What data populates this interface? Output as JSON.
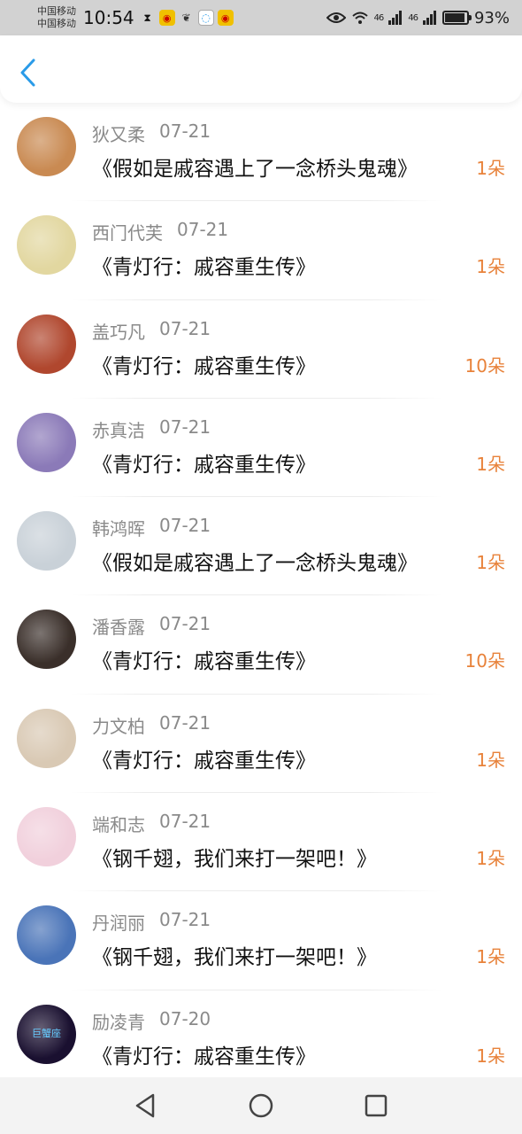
{
  "status": {
    "carrier1": "中国移动",
    "carrier2": "中国移动",
    "time": "10:54",
    "net1": "46",
    "net2": "46",
    "battery": "93%",
    "battery_level": 0.93
  },
  "header": {
    "back_icon": "chevron-left-icon",
    "accent": "#2a9be8"
  },
  "colors": {
    "count": "#e8823a",
    "name": "#8a8a8a"
  },
  "items": [
    {
      "name": "狄又柔",
      "date": "07-21",
      "title": "《假如是戚容遇上了一念桥头鬼魂》",
      "count": "1朵",
      "avatar_color": "#c98a52"
    },
    {
      "name": "西门代芙",
      "date": "07-21",
      "title": "《青灯行：戚容重生传》",
      "count": "1朵",
      "avatar_color": "#e2d7a0"
    },
    {
      "name": "盖巧凡",
      "date": "07-21",
      "title": "《青灯行：戚容重生传》",
      "count": "10朵",
      "avatar_color": "#b0472e"
    },
    {
      "name": "赤真洁",
      "date": "07-21",
      "title": "《青灯行：戚容重生传》",
      "count": "1朵",
      "avatar_color": "#8b7ab8"
    },
    {
      "name": "韩鸿晖",
      "date": "07-21",
      "title": "《假如是戚容遇上了一念桥头鬼魂》",
      "count": "1朵",
      "avatar_color": "#c9d1d8"
    },
    {
      "name": "潘香露",
      "date": "07-21",
      "title": "《青灯行：戚容重生传》",
      "count": "10朵",
      "avatar_color": "#3a2f2a"
    },
    {
      "name": "力文柏",
      "date": "07-21",
      "title": "《青灯行：戚容重生传》",
      "count": "1朵",
      "avatar_color": "#d9c9b4"
    },
    {
      "name": "端和志",
      "date": "07-21",
      "title": "《钢千翅，我们来打一架吧！》",
      "count": "1朵",
      "avatar_color": "#f1d0dc"
    },
    {
      "name": "丹润丽",
      "date": "07-21",
      "title": "《钢千翅，我们来打一架吧！》",
      "count": "1朵",
      "avatar_color": "#4a74b8"
    },
    {
      "name": "励凌青",
      "date": "07-20",
      "title": "《青灯行：戚容重生传》",
      "count": "1朵",
      "avatar_color": "#1a1030",
      "avatar_text": "巨蟹座"
    }
  ],
  "nav": {
    "back_icon": "triangle-back-icon",
    "home_icon": "circle-home-icon",
    "recent_icon": "square-recent-icon"
  }
}
